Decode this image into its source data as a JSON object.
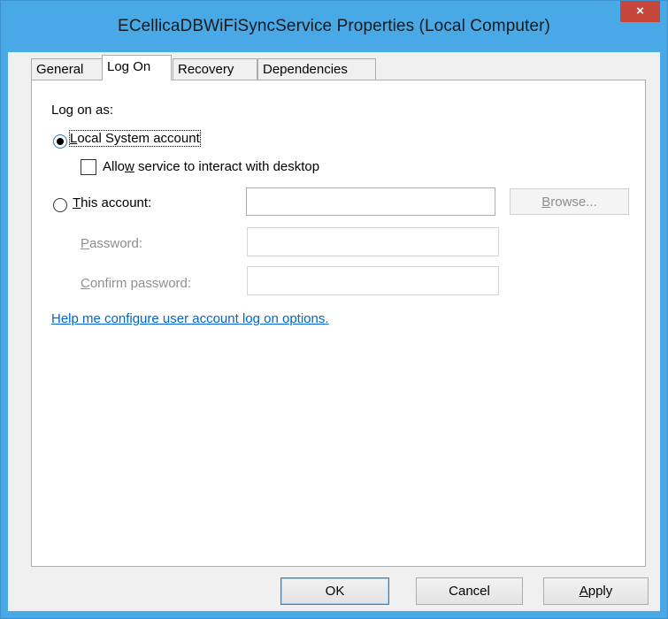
{
  "window": {
    "title": "ECellicaDBWiFiSyncService Properties (Local Computer)",
    "close_glyph": "×"
  },
  "tabs": [
    {
      "label": "General",
      "active": false
    },
    {
      "label": "Log On",
      "active": true
    },
    {
      "label": "Recovery",
      "active": false
    },
    {
      "label": "Dependencies",
      "active": false
    }
  ],
  "logon": {
    "heading": "Log on as:",
    "local_system": {
      "label_mn": "L",
      "label_rest": "ocal System account",
      "selected": true
    },
    "interact": {
      "label_pre": "Allo",
      "label_mn": "w",
      "label_rest": " service to interact with desktop",
      "checked": false
    },
    "this_account": {
      "label_mn": "T",
      "label_rest": "his account:",
      "selected": false,
      "value": ""
    },
    "browse": {
      "label_mn": "B",
      "label_rest": "rowse...",
      "enabled": false
    },
    "password": {
      "label_mn": "P",
      "label_rest": "assword:",
      "value": ""
    },
    "confirm": {
      "label_mn": "C",
      "label_rest": "onfirm password:",
      "value": ""
    },
    "help_link": "Help me configure user account log on options."
  },
  "buttons": {
    "ok": "OK",
    "cancel": "Cancel",
    "apply_mn": "A",
    "apply_rest": "pply"
  }
}
